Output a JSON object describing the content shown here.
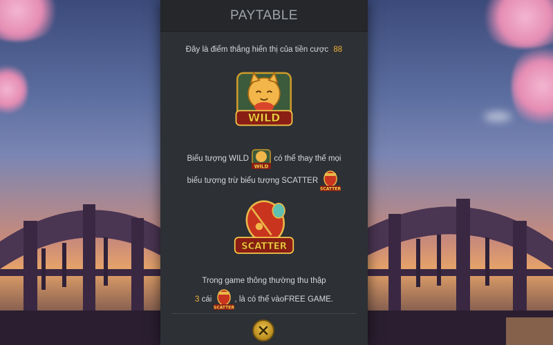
{
  "panel": {
    "title": "PAYTABLE",
    "intro_text": "Đây là điểm thắng hiển thị của tiền cược",
    "bet_value": "88",
    "wild_symbol": {
      "label": "WILD",
      "icon": "lucky-cat-icon"
    },
    "wild_desc": {
      "line1_before": "Biểu tượng WILD",
      "line1_after": "có thể thay thế mọi",
      "line2": "biểu tượng trừ biểu tượng SCATTER"
    },
    "scatter_symbol": {
      "label": "SCATTER",
      "icon": "lantern-drum-icon"
    },
    "scatter_desc": {
      "line1": "Trong game thông thường thu thập",
      "count": "3",
      "count_unit": "cái",
      "line2_after": ", là có thể vàoFREE GAME."
    },
    "close_icon": "close-x-icon"
  },
  "colors": {
    "panel_bg": "#2d3034",
    "header_bg": "#25272b",
    "accent": "#f0b33a",
    "text": "#d7d9dc"
  }
}
